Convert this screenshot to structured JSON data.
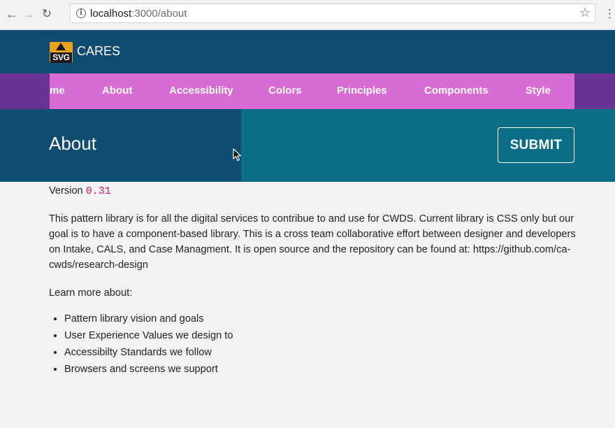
{
  "browser": {
    "url_host": "localhost",
    "url_path": ":3000/about"
  },
  "header": {
    "logo_text": "SVG",
    "brand": "CARES"
  },
  "nav": {
    "items": [
      {
        "label": "me"
      },
      {
        "label": "About"
      },
      {
        "label": "Accessibility"
      },
      {
        "label": "Colors"
      },
      {
        "label": "Principles"
      },
      {
        "label": "Components"
      },
      {
        "label": "Style"
      }
    ]
  },
  "banner": {
    "title": "About",
    "submit_label": "SUBMIT"
  },
  "content": {
    "version_label": "Version",
    "version_value": "0.31",
    "description": "This pattern library is for all the digital services to contribue to and use for CWDS. Current library is CSS only but our goal is to have a component-based library. This is a cross team collaborative effort between designer and developers on Intake, CALS, and Case Managment. It is open source and the repository can be found at: https://github.com/ca-cwds/research-design",
    "learn_more": "Learn more about:",
    "links": [
      {
        "label": "Pattern library vision and goals"
      },
      {
        "label": "User Experience Values we design to"
      },
      {
        "label": "Accessibilty Standards we follow"
      },
      {
        "label": "Browsers and screens we support"
      }
    ]
  },
  "icons": {
    "back": "arrow-left-icon",
    "forward": "arrow-right-icon",
    "reload": "reload-icon",
    "info": "info-icon",
    "bookmark": "star-icon",
    "menu": "kebab-menu-icon",
    "cursor": "mouse-pointer-icon"
  },
  "colors": {
    "header_bg": "#0f4c71",
    "nav_outer": "#693295",
    "nav_inner": "#d86bd4",
    "banner_right": "#0c6d87",
    "code_color": "#d4146e"
  }
}
